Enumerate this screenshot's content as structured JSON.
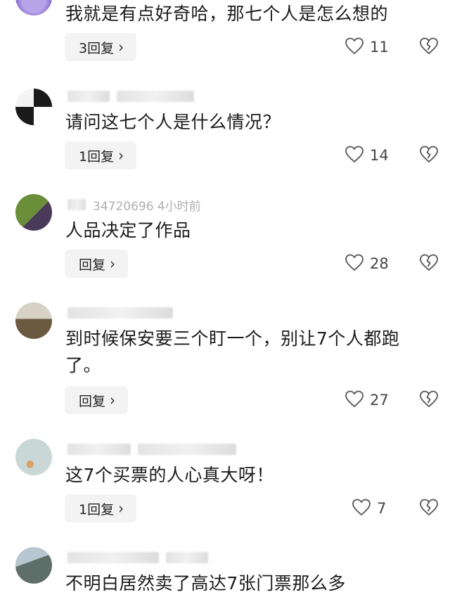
{
  "comments": [
    {
      "meta": "",
      "text": "我就是有点好奇哈，那七个人是怎么想的",
      "reply_label": "3回复",
      "likes": "11"
    },
    {
      "meta": "",
      "text": "请问这七个人是什么情况？",
      "reply_label": "1回复",
      "likes": "14"
    },
    {
      "meta": "34720696  4小时前",
      "text": "人品决定了作品",
      "reply_label": "回复",
      "likes": "28"
    },
    {
      "meta": "",
      "text": "到时候保安要三个盯一个，别让7个人都跑了。",
      "reply_label": "回复",
      "likes": "27"
    },
    {
      "meta": "",
      "text": "这7个买票的人心真大呀！",
      "reply_label": "1回复",
      "likes": "7"
    },
    {
      "meta": "",
      "text": "不明白居然卖了高达7张门票那么多",
      "reply_label": "",
      "likes": ""
    }
  ],
  "icons": {
    "like": "heart-outline-icon",
    "dislike": "broken-heart-icon",
    "reply_chevron": "chevron-right-icon"
  },
  "colors": {
    "reply_bg": "#f3f3f3",
    "icon_gray": "#555555",
    "meta_gray": "#b0b0b0"
  }
}
